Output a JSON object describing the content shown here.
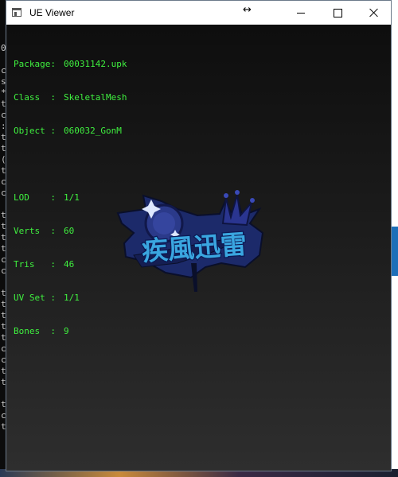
{
  "window": {
    "title": "UE Viewer",
    "controls": {
      "minimize": "minimize-icon",
      "maximize": "maximize-icon",
      "close": "close-icon"
    }
  },
  "mesh_info": {
    "package": {
      "label": "Package:",
      "value": "00031142.upk"
    },
    "class": {
      "label": "Class  :",
      "value": "SkeletalMesh"
    },
    "object": {
      "label": "Object :",
      "value": "060032_GonM"
    },
    "lod": {
      "label": "LOD    :",
      "value": "1/1"
    },
    "verts": {
      "label": "Verts  :",
      "value": "60"
    },
    "tris": {
      "label": "Tris   :",
      "value": "46"
    },
    "uv_set": {
      "label": "UV Set :",
      "value": "1/1"
    },
    "bones": {
      "label": "Bones  :",
      "value": "9"
    }
  },
  "model": {
    "glyphs": "疾風迅雷"
  },
  "colors": {
    "info_text": "#3ff03f",
    "viewport_top": "#0e0e0e",
    "viewport_bottom": "#2e2e2e",
    "logo_blue": "#3aa6e0",
    "logo_dark": "#1c2a6a"
  }
}
